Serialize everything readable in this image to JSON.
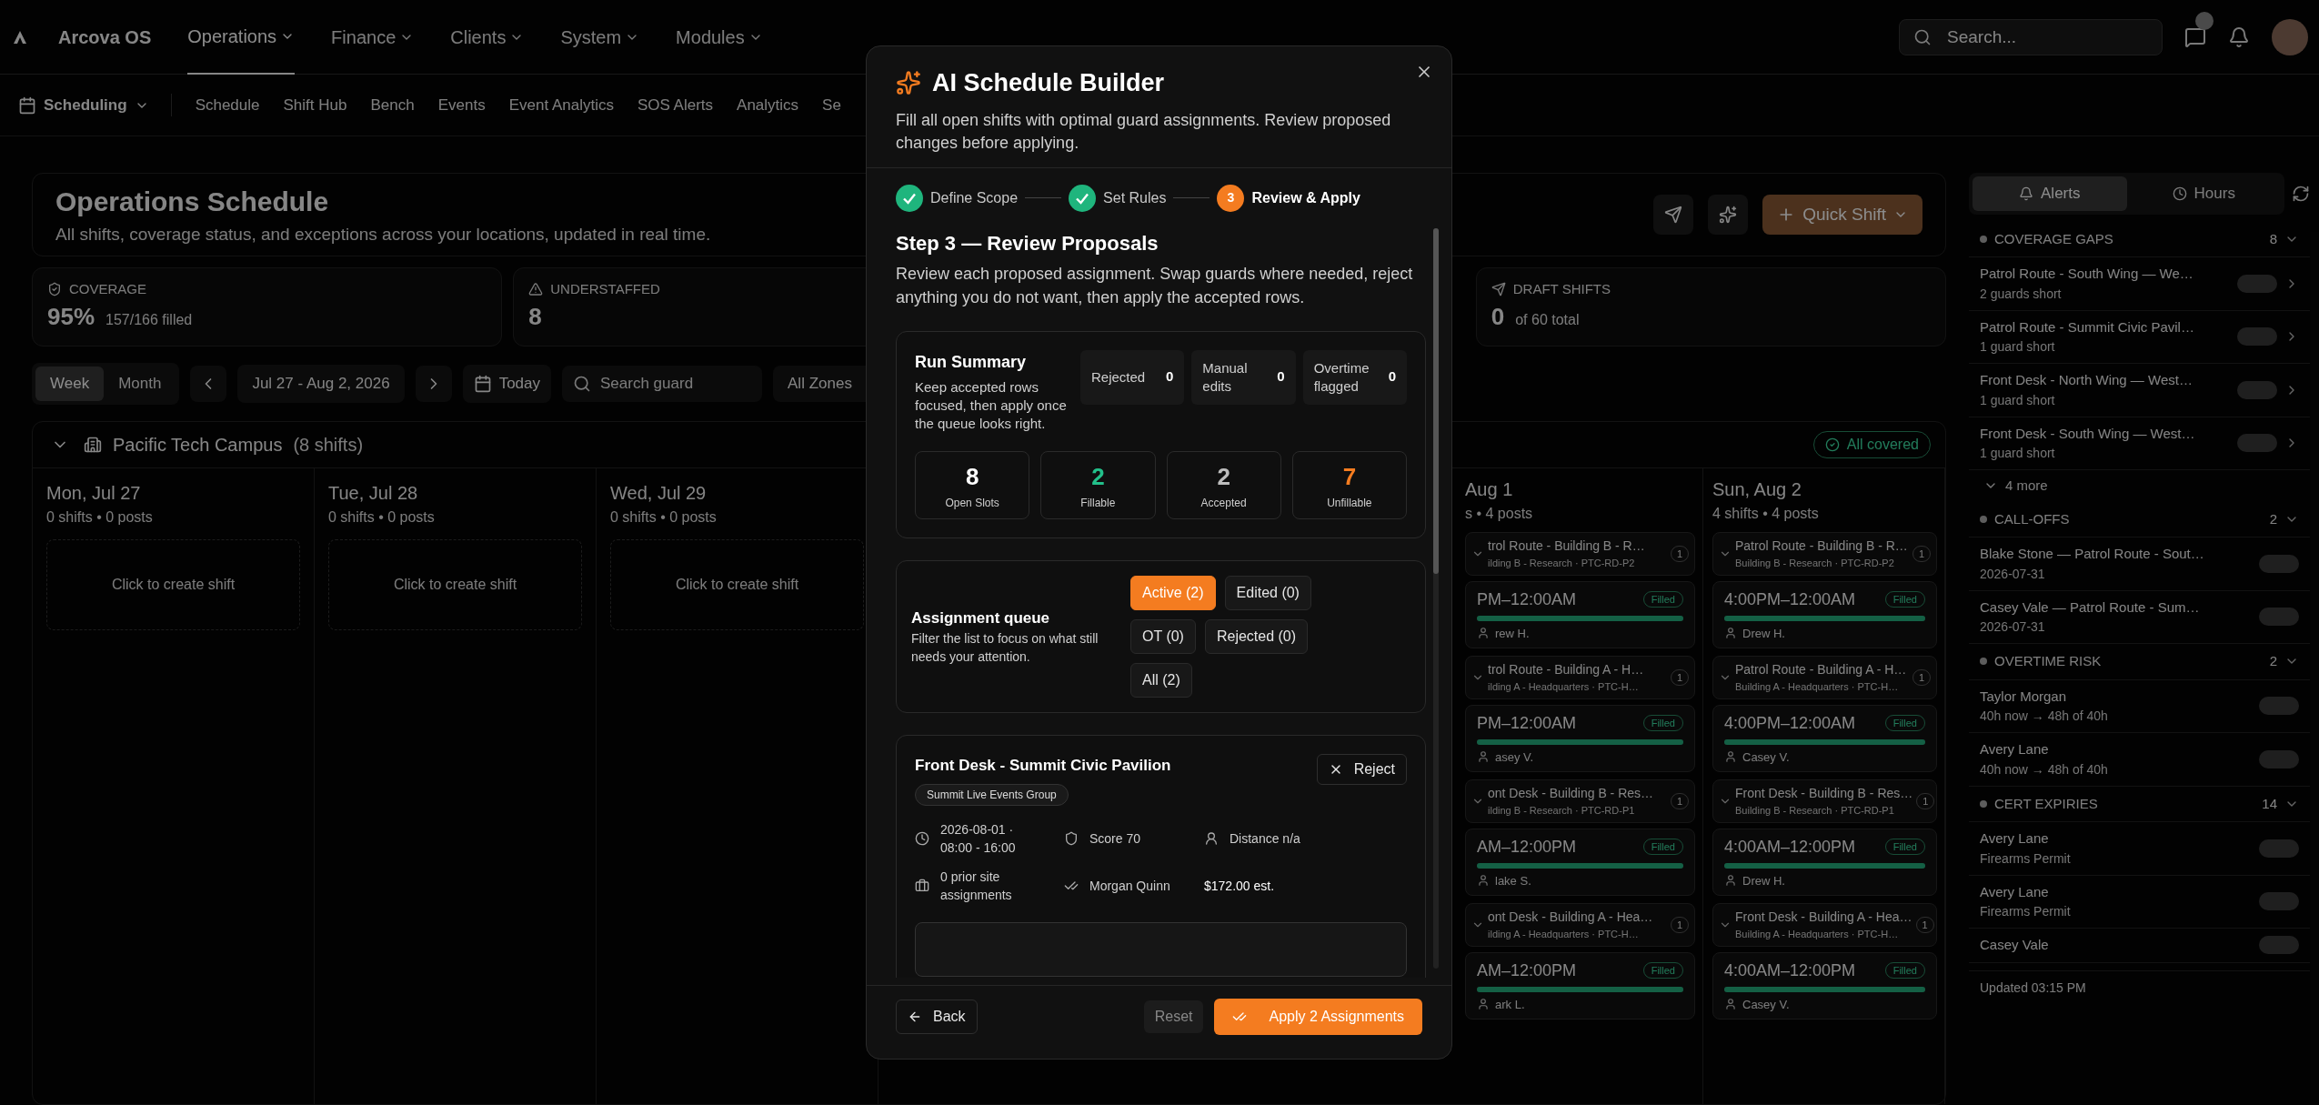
{
  "nav": {
    "brand": "Arcova OS",
    "items": [
      {
        "label": "Operations",
        "selected": true
      },
      {
        "label": "Finance",
        "selected": false
      },
      {
        "label": "Clients",
        "selected": false
      },
      {
        "label": "System",
        "selected": false
      },
      {
        "label": "Modules",
        "selected": false
      }
    ],
    "search": {
      "placeholder": "Search..."
    }
  },
  "subnav": {
    "module": "Scheduling",
    "tabs": [
      {
        "label": "Schedule"
      },
      {
        "label": "Shift Hub"
      },
      {
        "label": "Bench"
      },
      {
        "label": "Events"
      },
      {
        "label": "Event Analytics"
      },
      {
        "label": "SOS Alerts"
      },
      {
        "label": "Analytics"
      },
      {
        "label": "Se"
      }
    ]
  },
  "header": {
    "title": "Operations Schedule",
    "subtitle": "All shifts, coverage status, and exceptions across your locations, updated in real time.",
    "quick_shift": "Quick Shift"
  },
  "stats": [
    {
      "kind": "coverage",
      "label": "COVERAGE",
      "value": "95%",
      "detail": "157/166 filled"
    },
    {
      "kind": "understaffed",
      "label": "UNDERSTAFFED",
      "value": "8"
    },
    {
      "kind": "drafts",
      "label": "DRAFT SHIFTS",
      "value": "0",
      "detail": "of 60 total"
    }
  ],
  "toolbar": {
    "views": [
      {
        "label": "Week",
        "selected": true
      },
      {
        "label": "Month",
        "selected": false
      }
    ],
    "range": "Jul 27 - Aug 2, 2026",
    "today": "Today",
    "search": {
      "placeholder": "Search guard"
    },
    "zone": "All Zones"
  },
  "location": {
    "name": "Pacific Tech Campus",
    "count": "(8 shifts)",
    "status": "All covered",
    "expanded": true
  },
  "days": [
    {
      "date": "Mon, Jul 27",
      "meta": "0 shifts • 0 posts",
      "empty": "Click to create shift"
    },
    {
      "date": "Tue, Jul 28",
      "meta": "0 shifts • 0 posts",
      "empty": "Click to create shift"
    },
    {
      "date": "Wed, Jul 29",
      "meta": "0 shifts • 0 posts",
      "empty": "Click to create shift"
    }
  ],
  "days_right": [
    {
      "date": "Aug 1",
      "meta": "s • 4 posts",
      "shifts": [
        {
          "title": "trol Route - Building B - R…",
          "site": "ilding B - Research · PTC-RD-P2",
          "count": "1",
          "time": "PM–12:00AM",
          "status": "Filled",
          "level": 1,
          "guard": "rew H."
        },
        {
          "title": "trol Route - Building A - H…",
          "site": "ilding A - Headquarters · PTC-H…",
          "count": "1",
          "time": "PM–12:00AM",
          "status": "Filled",
          "level": 1,
          "guard": "asey V."
        },
        {
          "title": "ont Desk - Building B - Res…",
          "site": "ilding B - Research · PTC-RD-P1",
          "count": "1",
          "time": "AM–12:00PM",
          "status": "Filled",
          "level": 1,
          "guard": "lake S."
        },
        {
          "title": "ont Desk - Building A - Hea…",
          "site": "ilding A - Headquarters · PTC-H…",
          "count": "1",
          "time": "AM–12:00PM",
          "status": "Filled",
          "level": 1,
          "guard": "ark L."
        }
      ]
    },
    {
      "date": "Sun, Aug 2",
      "meta": "4 shifts • 4 posts",
      "shifts": [
        {
          "title": "Patrol Route - Building B - R…",
          "site": "Building B - Research · PTC-RD-P2",
          "count": "1",
          "time": "4:00PM–12:00AM",
          "status": "Filled",
          "level": 1,
          "guard": "Drew H."
        },
        {
          "title": "Patrol Route - Building A - H…",
          "site": "Building A - Headquarters · PTC-H…",
          "count": "1",
          "time": "4:00PM–12:00AM",
          "status": "Filled",
          "level": 1,
          "guard": "Casey V."
        },
        {
          "title": "Front Desk - Building B - Res…",
          "site": "Building B - Research · PTC-RD-P1",
          "count": "1",
          "time": "4:00AM–12:00PM",
          "status": "Filled",
          "level": 1,
          "guard": "Drew H."
        },
        {
          "title": "Front Desk - Building A - Hea…",
          "site": "Building A - Headquarters · PTC-H…",
          "count": "1",
          "time": "4:00AM–12:00PM",
          "status": "Filled",
          "level": 1,
          "guard": "Casey V."
        }
      ]
    }
  ],
  "panel": {
    "tabs": [
      {
        "label": "Alerts",
        "selected": true
      },
      {
        "label": "Hours",
        "selected": false
      }
    ],
    "sections": [
      {
        "title": "COVERAGE GAPS",
        "count": "8",
        "items": [
          {
            "title": "Patrol Route - South Wing — We…",
            "detail": "2 guards short"
          },
          {
            "title": "Patrol Route - Summit Civic Pavil…",
            "detail": "1 guard short"
          },
          {
            "title": "Front Desk - North Wing — West…",
            "detail": "1 guard short"
          },
          {
            "title": "Front Desk - South Wing — West…",
            "detail": "1 guard short"
          }
        ],
        "more": "4 more"
      },
      {
        "title": "CALL-OFFS",
        "count": "2",
        "items": [
          {
            "title": "Blake Stone — Patrol Route - Sout…",
            "detail": "2026-07-31"
          },
          {
            "title": "Casey Vale — Patrol Route - Sum…",
            "detail": "2026-07-31"
          }
        ]
      },
      {
        "title": "OVERTIME RISK",
        "count": "2",
        "items": [
          {
            "title": "Taylor Morgan",
            "detail": "40h now → 48h of 40h"
          },
          {
            "title": "Avery Lane",
            "detail": "40h now → 48h of 40h"
          }
        ]
      },
      {
        "title": "CERT EXPIRIES",
        "count": "14",
        "items": [
          {
            "title": "Avery Lane",
            "detail": "Firearms Permit"
          },
          {
            "title": "Avery Lane",
            "detail": "Firearms Permit"
          },
          {
            "title": "Casey Vale"
          }
        ]
      }
    ],
    "footer": "Updated 03:15 PM"
  },
  "modal": {
    "title": "AI Schedule Builder",
    "description": "Fill all open shifts with optimal guard assignments. Review proposed changes before applying.",
    "steps": [
      {
        "label": "Define Scope",
        "completed": true
      },
      {
        "label": "Set Rules",
        "completed": true
      },
      {
        "label": "Review & Apply",
        "completed": false,
        "number": "3"
      }
    ],
    "heading": "Step 3 — Review Proposals",
    "intro": "Review each proposed assignment. Swap guards where needed, reject anything you do not want, then apply the accepted rows.",
    "summary": {
      "title": "Run Summary",
      "text": "Keep accepted rows focused, then apply once the queue looks right.",
      "counters": [
        {
          "label": "Rejected",
          "value": "0"
        },
        {
          "label": "Manual edits",
          "value": "0"
        },
        {
          "label": "Overtime flagged",
          "value": "0"
        }
      ],
      "tiles": [
        {
          "label": "Open Slots",
          "value": "8",
          "color": "#ffffff"
        },
        {
          "label": "Fillable",
          "value": "2",
          "color": "#22c08a"
        },
        {
          "label": "Accepted",
          "value": "2",
          "color": "#bdbdbd"
        },
        {
          "label": "Unfillable",
          "value": "7",
          "color": "#f47c20"
        }
      ]
    },
    "queue": {
      "title": "Assignment queue",
      "text": "Filter the list to focus on what still needs your attention.",
      "filters": [
        {
          "label": "Active (2)",
          "selected": true
        },
        {
          "label": "Edited (0)",
          "selected": false
        },
        {
          "label": "OT (0)",
          "selected": false
        },
        {
          "label": "Rejected (0)",
          "selected": false
        },
        {
          "label": "All (2)",
          "selected": false
        }
      ]
    },
    "proposal": {
      "title": "Front Desk - Summit Civic Pavilion",
      "tag": "Summit Live Events Group",
      "reject": "Reject",
      "details": [
        "2026-08-01 · 08:00 - 16:00",
        "Score 70",
        "Distance n/a",
        "0 prior site assignments",
        "Morgan Quinn",
        "$172.00 est."
      ]
    },
    "back": "Back",
    "reset": {
      "label": "Reset",
      "disabled": true
    },
    "apply": "Apply 2 Assignments"
  }
}
